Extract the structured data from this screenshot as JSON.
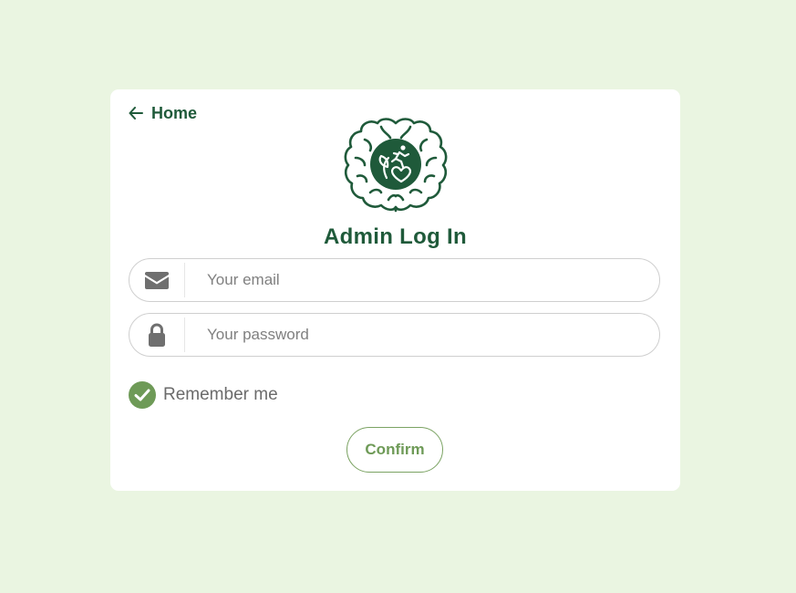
{
  "nav": {
    "home_label": "Home"
  },
  "form": {
    "title": "Admin Log In",
    "email": {
      "placeholder": "Your email",
      "value": ""
    },
    "password": {
      "placeholder": "Your password",
      "value": ""
    },
    "remember_label": "Remember me",
    "remember_checked": true,
    "confirm_label": "Confirm"
  },
  "icons": {
    "home": "arrow-left-icon",
    "logo": "brain-logo",
    "email": "envelope-icon",
    "password": "lock-icon",
    "remember": "checkmark-icon"
  },
  "colors": {
    "background": "#eaf5e1",
    "brand_dark": "#1f5a3a",
    "accent": "#6e9a57",
    "icon_gray": "#6f6f6f"
  }
}
